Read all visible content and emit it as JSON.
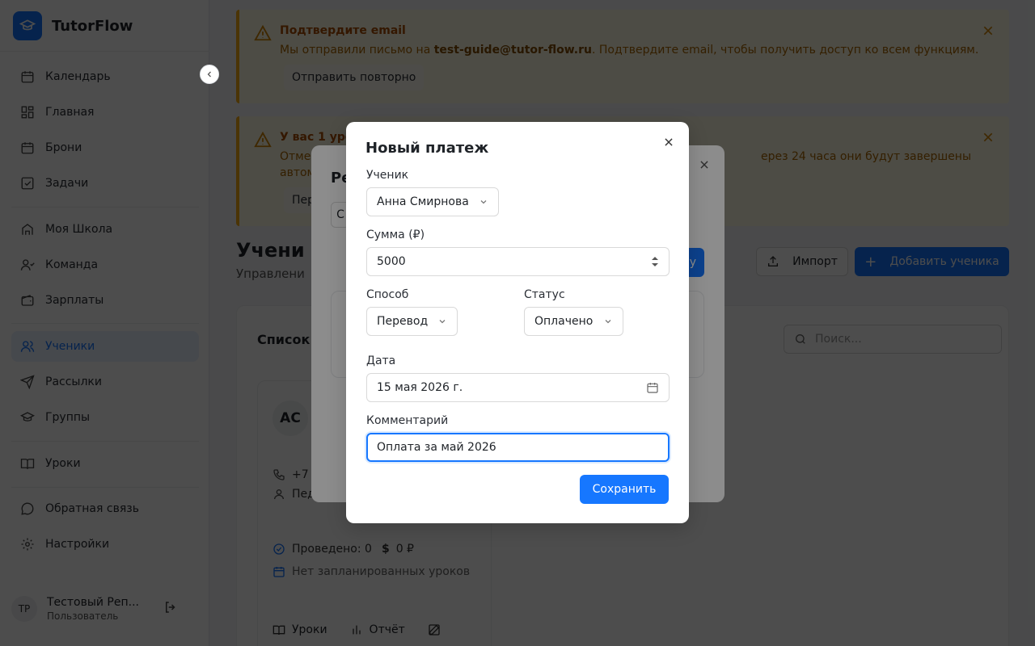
{
  "app": {
    "name": "TutorFlow"
  },
  "sidebar": {
    "items": [
      {
        "label": "Календарь",
        "icon": "calendar-icon"
      },
      {
        "label": "Главная",
        "icon": "dashboard-icon"
      },
      {
        "label": "Брони",
        "icon": "calendar-icon"
      },
      {
        "label": "Задачи",
        "icon": "checkbox-icon"
      },
      {
        "label": "Моя Школа",
        "icon": "school-icon"
      },
      {
        "label": "Команда",
        "icon": "team-icon"
      },
      {
        "label": "Зарплаты",
        "icon": "wallet-icon"
      },
      {
        "label": "Ученики",
        "icon": "users-icon",
        "active": true
      },
      {
        "label": "Рассылки",
        "icon": "send-icon"
      },
      {
        "label": "Группы",
        "icon": "graduation-cap-icon"
      },
      {
        "label": "Уроки",
        "icon": "book-icon"
      },
      {
        "label": "Обратная связь",
        "icon": "chat-icon"
      },
      {
        "label": "Настройки",
        "icon": "gear-icon"
      }
    ],
    "user": {
      "initials": "ТР",
      "name": "Тестовый Реп...",
      "role": "Пользователь"
    }
  },
  "banners": [
    {
      "title": "Подтвердите email",
      "text_before": "Мы отправили письмо на ",
      "email": "test-guide@tutor-flow.ru",
      "text_after": ". Подтвердите email, чтобы получить доступ ко всем функциям.",
      "button": "Отправить повторно"
    },
    {
      "title_partial": "У вас 1 урок",
      "text_partial_1": "Отме",
      "text_partial_2": "ерез 24 часа они будут завершены",
      "text_partial_3": "автом",
      "button_partial": "Пер"
    }
  ],
  "page": {
    "title_partial": "Учени",
    "subtitle_partial": "Управлени",
    "import_button": "Импорт",
    "add_button": "Добавить ученика",
    "list_title_partial": "Список",
    "search_placeholder": "Поиск..."
  },
  "student_card": {
    "initials": "АС",
    "phone_partial": "+7",
    "teacher_partial": "Пед",
    "conducted": "Проведено: 0",
    "amount": "0 ₽",
    "no_lessons": "Нет запланированных уроков",
    "lessons_button": "Уроки",
    "report_button": "Отчёт"
  },
  "back_modal": {
    "title_partial": "Ре",
    "chip_partial": "С",
    "button_partial": "у"
  },
  "modal": {
    "title": "Новый платеж",
    "student_label": "Ученик",
    "student_value": "Анна Смирнова",
    "amount_label": "Сумма (₽)",
    "amount_value": "5000",
    "method_label": "Способ",
    "method_value": "Перевод",
    "status_label": "Статус",
    "status_value": "Оплачено",
    "date_label": "Дата",
    "date_value": "15 мая 2026 г.",
    "comment_label": "Комментарий",
    "comment_value": "Оплата за май 2026",
    "save_button": "Сохранить"
  },
  "colors": {
    "accent": "#1677ff",
    "warning_border": "#faad14",
    "warning_bg": "#fffbe6"
  }
}
